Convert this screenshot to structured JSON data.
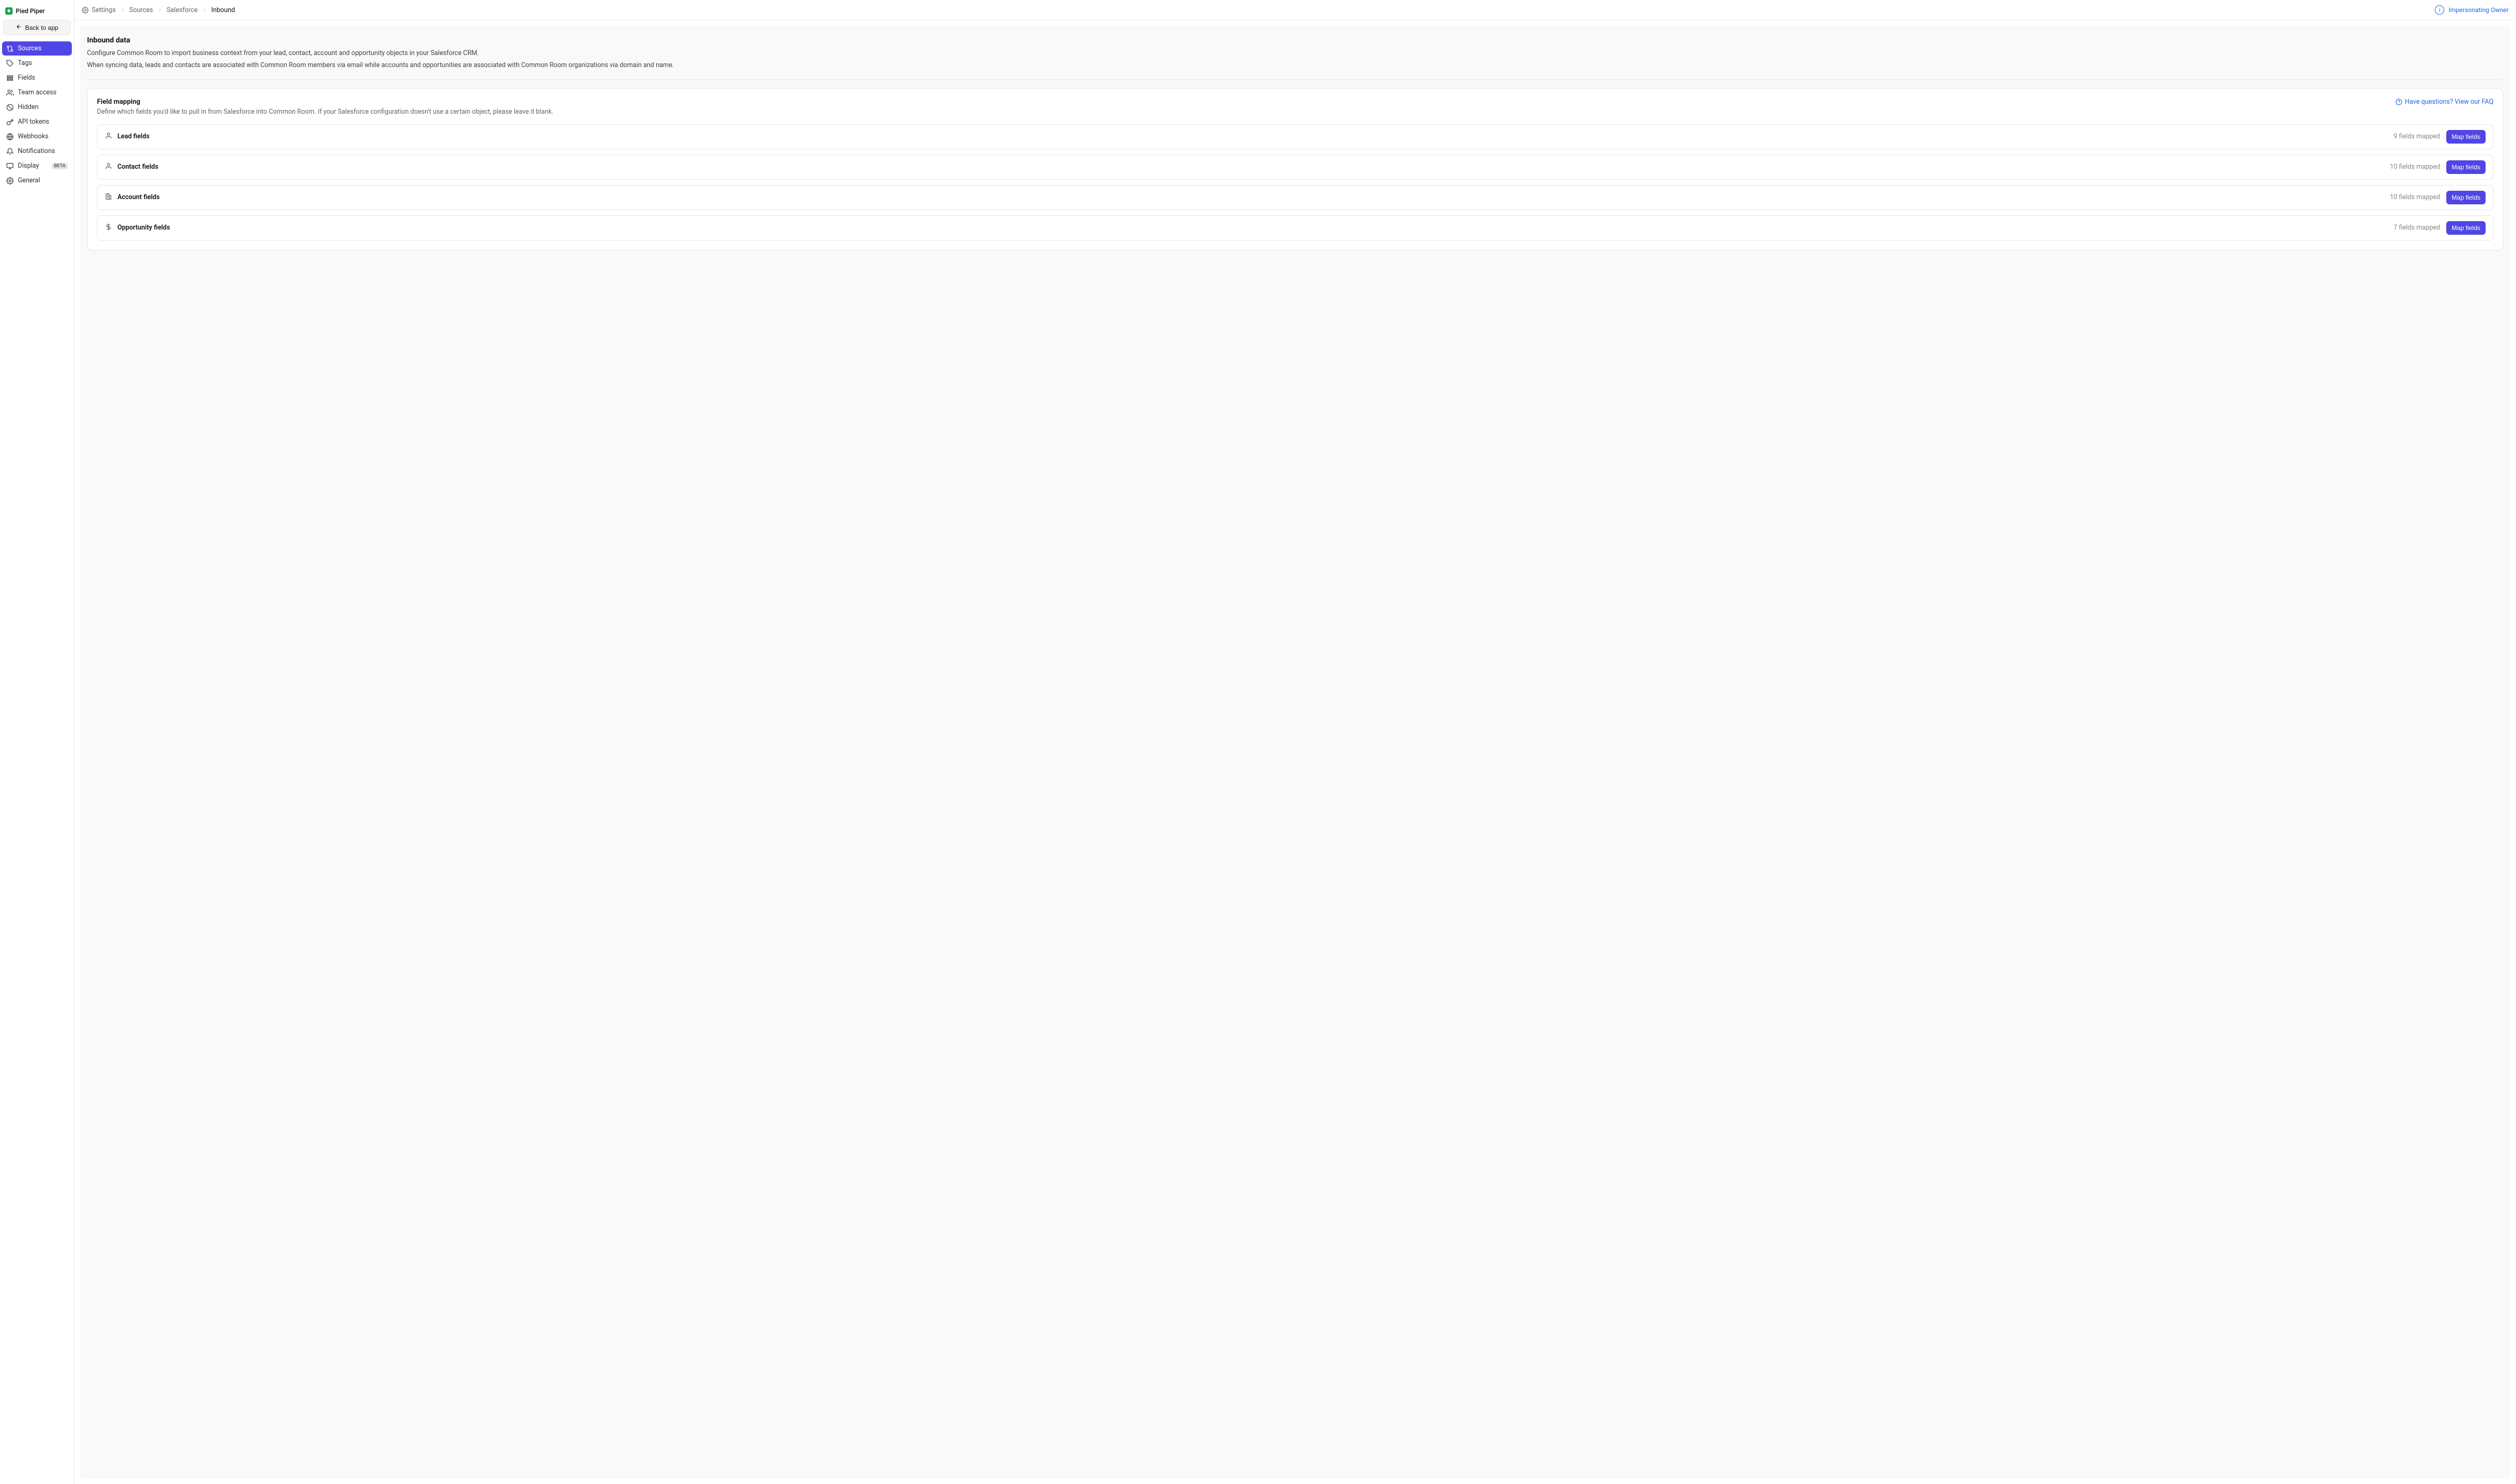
{
  "workspace": {
    "name": "Pied Piper"
  },
  "sidebar": {
    "back_label": "Back to app",
    "items": [
      {
        "label": "Sources"
      },
      {
        "label": "Tags"
      },
      {
        "label": "Fields"
      },
      {
        "label": "Team access"
      },
      {
        "label": "Hidden"
      },
      {
        "label": "API tokens"
      },
      {
        "label": "Webhooks"
      },
      {
        "label": "Notifications"
      },
      {
        "label": "Display",
        "badge": "BETA"
      },
      {
        "label": "General"
      }
    ]
  },
  "breadcrumb": {
    "items": [
      {
        "label": "Settings"
      },
      {
        "label": "Sources"
      },
      {
        "label": "Salesforce"
      },
      {
        "label": "Inbound"
      }
    ]
  },
  "impersonation": {
    "label": "Impersonating Owner",
    "icon_char": "i"
  },
  "page": {
    "title": "Inbound data",
    "desc1": "Configure Common Room to import business context from your lead, contact, account and opportunity objects in your Salesforce CRM.",
    "desc2": "When syncing data, leads and contacts are associated with Common Room members via email while accounts and opportunities are associated with Common Room organizations via domain and name."
  },
  "mapping": {
    "heading": "Field mapping",
    "subheading": "Define which fields you'd like to pull in from Salesforce into Common Room. If your Salesforce configuration doesn't use a certain object, please leave it blank.",
    "faq_label": "Have questions? View our FAQ",
    "button_label": "Map fields",
    "rows": [
      {
        "label": "Lead fields",
        "count_text": "9 fields mapped"
      },
      {
        "label": "Contact fields",
        "count_text": "10 fields mapped"
      },
      {
        "label": "Account fields",
        "count_text": "10 fields mapped"
      },
      {
        "label": "Opportunity fields",
        "count_text": "7 fields mapped"
      }
    ]
  }
}
